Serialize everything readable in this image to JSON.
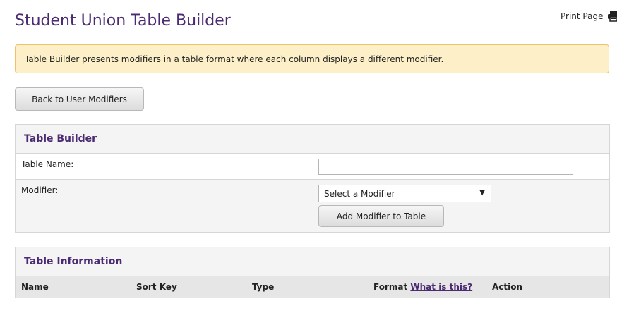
{
  "page": {
    "title": "Student Union Table Builder",
    "print_label": "Print Page",
    "print_icon": "printer-icon"
  },
  "notice": {
    "text": "Table Builder presents modifiers in a table format where each column displays a different modifier."
  },
  "back_button": {
    "label": "Back to User Modifiers"
  },
  "table_builder": {
    "header": "Table Builder",
    "table_name_label": "Table Name:",
    "table_name_value": "",
    "modifier_label": "Modifier:",
    "modifier_select": "Select a Modifier",
    "add_button": "Add Modifier to Table"
  },
  "table_information": {
    "header": "Table Information",
    "columns": {
      "name": "Name",
      "sort_key": "Sort Key",
      "type": "Type",
      "format": "Format",
      "format_link": "What is this?",
      "action": "Action"
    }
  },
  "colors": {
    "brand_purple": "#4b2a72",
    "notice_bg": "#fdf0c8",
    "notice_border": "#efc26a"
  }
}
